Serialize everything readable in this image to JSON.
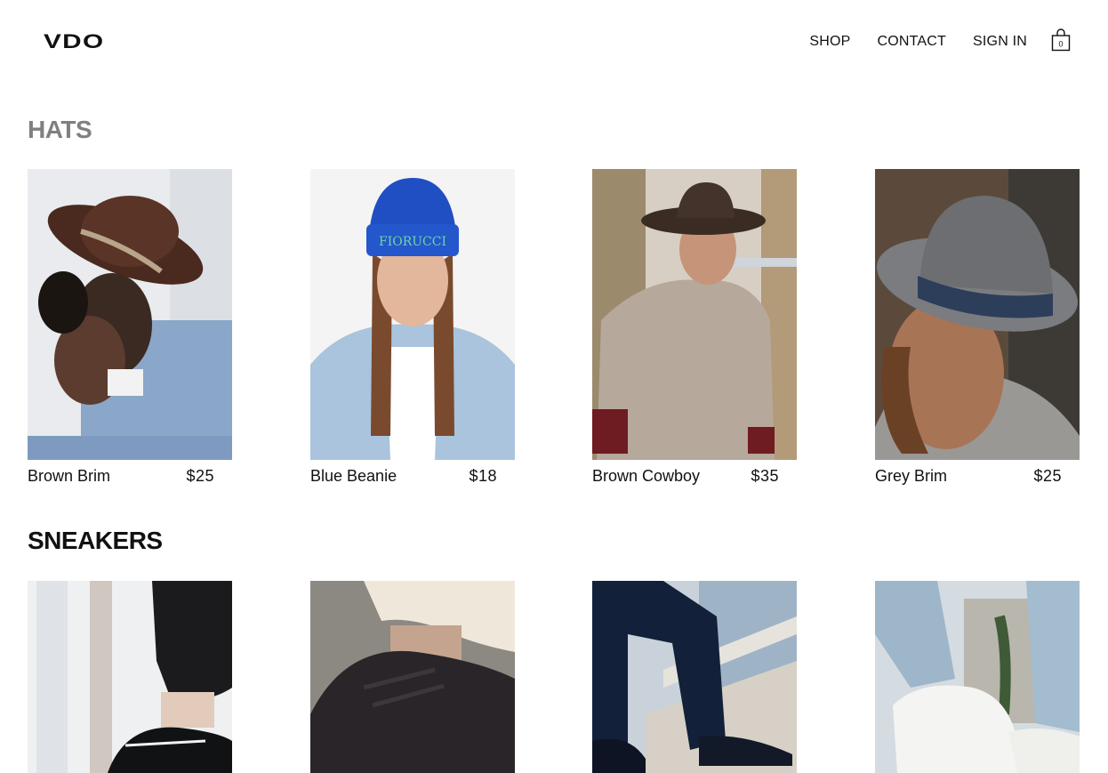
{
  "header": {
    "logo": "VDO",
    "nav": [
      {
        "label": "SHOP"
      },
      {
        "label": "CONTACT"
      },
      {
        "label": "SIGN IN"
      }
    ],
    "cart_icon": "shopping-bag-icon"
  },
  "sections": [
    {
      "title": "HATS",
      "products": [
        {
          "name": "Brown Brim",
          "price": "$25"
        },
        {
          "name": "Blue Beanie",
          "price": "$18"
        },
        {
          "name": "Brown Cowboy",
          "price": "$35"
        },
        {
          "name": "Grey Brim",
          "price": "$25"
        }
      ]
    },
    {
      "title": "SNEAKERS",
      "products": [
        {
          "name": "",
          "price": ""
        },
        {
          "name": "",
          "price": ""
        },
        {
          "name": "",
          "price": ""
        },
        {
          "name": "",
          "price": ""
        }
      ]
    }
  ],
  "colors": {
    "hats_title": "#808080",
    "sneakers_title": "#111111"
  }
}
